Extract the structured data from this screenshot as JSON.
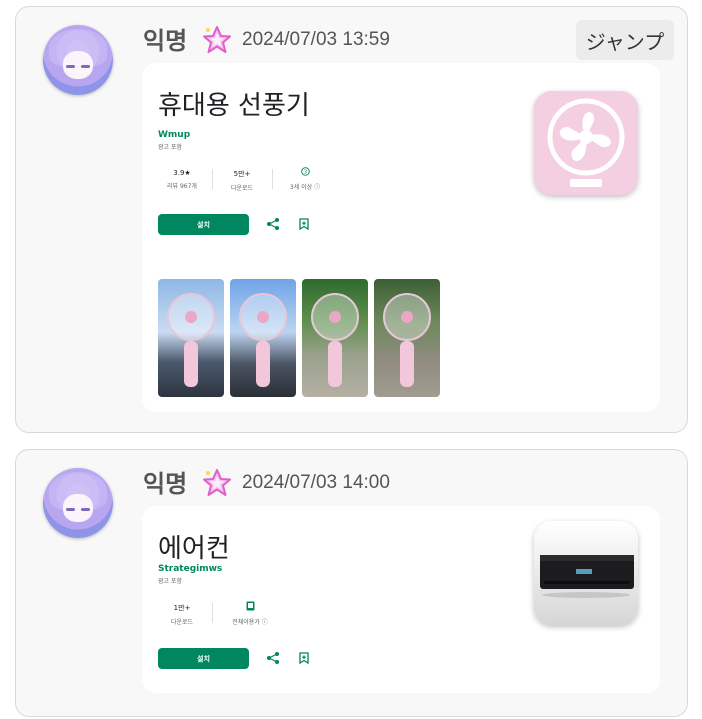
{
  "posts": [
    {
      "name": "익명",
      "time": "2024/07/03 13:59",
      "jump_label": "ジャンプ",
      "app": {
        "title": "휴대용 선풍기",
        "developer": "Wmup",
        "ads_note": "광고 포함",
        "stats": [
          {
            "value": "3.9★",
            "label": "리뷰 967개"
          },
          {
            "value": "5만+",
            "label": "다운로드"
          },
          {
            "value": "3",
            "label": "3세 이상 ⓘ"
          }
        ],
        "install_label": "설치",
        "icon": "pink-fan-app-icon",
        "screenshot_count": 4
      }
    },
    {
      "name": "익명",
      "time": "2024/07/03 14:00",
      "app": {
        "title": "에어컨",
        "developer": "Strategimws",
        "ads_note": "광고 포함",
        "stats": [
          {
            "value": "1만+",
            "label": "다운로드"
          },
          {
            "value": "",
            "label": "전체이용가 ⓘ"
          }
        ],
        "install_label": "설치",
        "icon": "air-conditioner-app-icon"
      }
    }
  ],
  "colors": {
    "play_green": "#01875f",
    "star_pink": "#e060c8",
    "fan_pink": "#f3cfe1",
    "text_gray": "#555555"
  }
}
